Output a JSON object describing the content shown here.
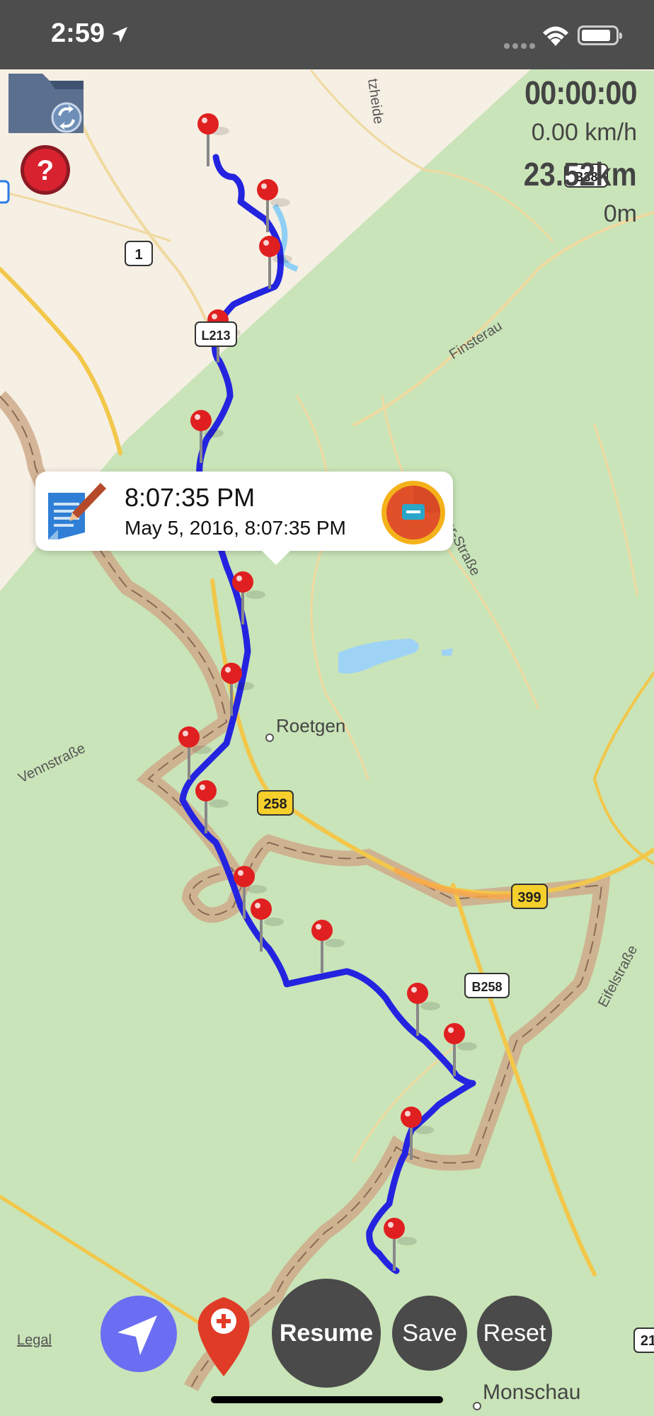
{
  "status_bar": {
    "time": "2:59"
  },
  "stats": {
    "elapsed": "00:00:00",
    "speed": "0.00 km/h",
    "distance": "23.52km",
    "altitude": "0m"
  },
  "map": {
    "labels": {
      "place_roetgen": "Roetgen",
      "place_monschau": "Monschau",
      "street_finsterau": "Finsterau",
      "street_vennstrasse": "Vennstraße",
      "street_eifelstrasse": "Eifelstraße",
      "street_partial": "er-Straße",
      "area_partial": "tzheide"
    },
    "road_badges": {
      "r1": "1",
      "l213": "L213",
      "r258": "258",
      "r399": "399",
      "b258": "B258",
      "b_top": "B38",
      "r21": "21"
    },
    "legal": "Legal"
  },
  "callout": {
    "title": "8:07:35 PM",
    "subtitle": "May 5, 2016, 8:07:35 PM"
  },
  "controls": {
    "resume_label": "Resume",
    "save_label": "Save",
    "reset_label": "Reset"
  },
  "icons": {
    "status": [
      "location-arrow-icon",
      "signal-icon",
      "wifi-icon",
      "battery-icon"
    ],
    "map": [
      "folder-sync-icon",
      "help-icon",
      "map-pin-icon",
      "note-edit-icon",
      "remove-icon",
      "navigation-arrow-icon",
      "add-pin-icon"
    ]
  },
  "colors": {
    "route": "#2424e0",
    "pin": "#e02020",
    "nav_button": "#6b6ef2",
    "action_button": "#4a4a4a",
    "map_forest": "#c9e4b8",
    "map_urban": "#f6efe3"
  }
}
